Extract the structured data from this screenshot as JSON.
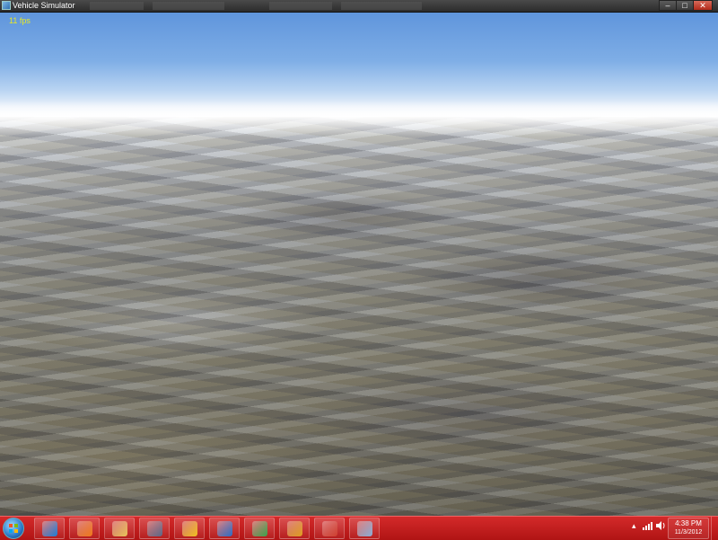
{
  "window": {
    "title": "Vehicle Simulator",
    "controls": {
      "minimize": "–",
      "maximize": "□",
      "close": "✕"
    }
  },
  "viewport": {
    "fps_text": "11 fps",
    "scene": "terrain-flyover"
  },
  "taskbar": {
    "accent_color": "#c01c1c",
    "start_icon": "windows-orb-icon",
    "pinned": [
      {
        "name": "internet-explorer-icon",
        "color": "#1e7fd8"
      },
      {
        "name": "media-player-icon",
        "color": "#f07a1a"
      },
      {
        "name": "file-explorer-icon",
        "color": "#e8c35a"
      },
      {
        "name": "window-app-icon",
        "color": "#5a6a8a"
      },
      {
        "name": "yellow-app-icon",
        "color": "#f0c020"
      },
      {
        "name": "google-earth-icon",
        "color": "#2b6fc8"
      },
      {
        "name": "chrome-icon",
        "color": "#3da34d"
      },
      {
        "name": "notebook-app-icon",
        "color": "#e0a020"
      },
      {
        "name": "paint-app-icon",
        "color": "#d04030"
      },
      {
        "name": "vehicle-simulator-icon",
        "color": "#8ab0d8"
      }
    ],
    "tray": {
      "show_hidden_icon": "▴",
      "network_icon": "network-signal-icon",
      "volume_icon": "volume-icon",
      "time": "4:38 PM",
      "date": "11/3/2012"
    }
  }
}
